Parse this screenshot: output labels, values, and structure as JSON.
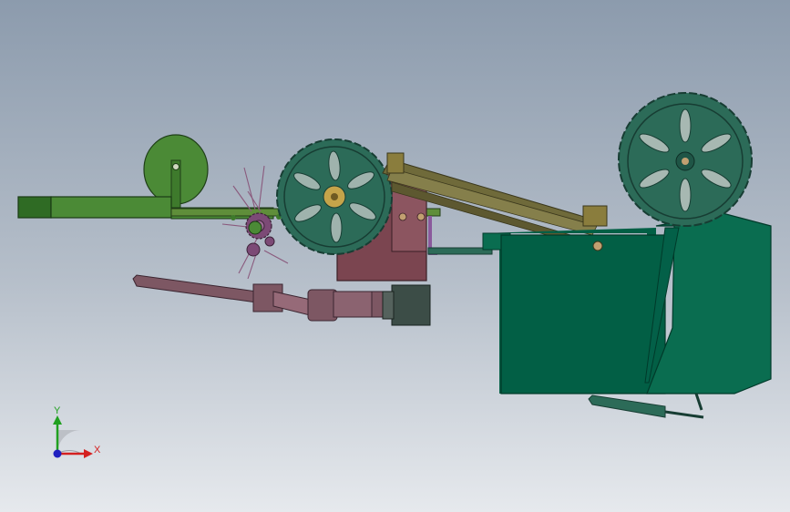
{
  "axes": {
    "x_label": "X",
    "y_label": "Y",
    "x_color": "#d42020",
    "y_color": "#20a020",
    "z_color": "#2020c0"
  },
  "colors": {
    "machine_green": "#025f45",
    "machine_green_light": "#0a6d50",
    "frame_green": "#4b8a36",
    "frame_green_dark": "#2f6b24",
    "gearbox_mauve": "#7b4550",
    "gearbox_mauve_light": "#8c5560",
    "wheel_green": "#2c6b58",
    "wheel_green_dark": "#1f5546",
    "boom_olive": "#6f6a3a",
    "shaft_mauve": "#7d5763",
    "motor_gray": "#3c4d47",
    "background_top": "#8c9bad",
    "background_bottom": "#e6e9ed"
  }
}
